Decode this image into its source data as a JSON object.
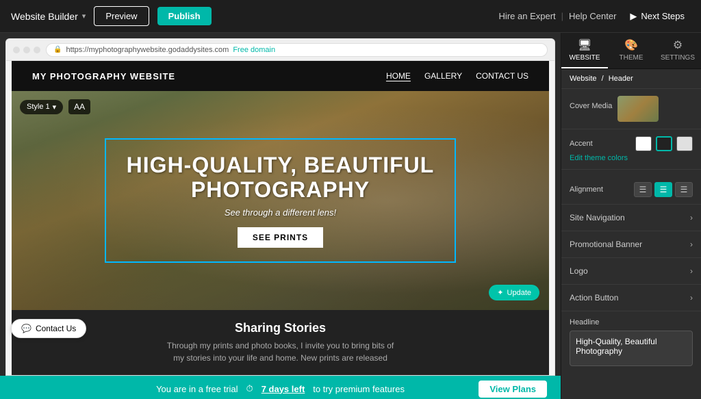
{
  "topbar": {
    "brand": "Website Builder",
    "chevron": "▾",
    "preview_label": "Preview",
    "publish_label": "Publish",
    "hire_expert": "Hire an Expert",
    "help_center": "Help Center",
    "next_steps": "Next Steps",
    "separator": "|"
  },
  "browser": {
    "url": "https://myphotographywebsite.godaddysites.com",
    "free_domain": "Free domain"
  },
  "site": {
    "logo": "MY PHOTOGRAPHY WEBSITE",
    "nav": [
      {
        "label": "HOME",
        "active": true
      },
      {
        "label": "GALLERY",
        "active": false
      },
      {
        "label": "CONTACT US",
        "active": false
      }
    ]
  },
  "hero": {
    "style_label": "Style 1",
    "aa_label": "AA",
    "title_line1": "HIGH-QUALITY, BEAUTIFUL",
    "title_line2": "PHOTOGRAPHY",
    "subtitle": "See through a different lens!",
    "button_label": "SEE PRINTS",
    "update_badge": "Update"
  },
  "below_fold": {
    "title": "Sharing Stories",
    "text": "Through my prints and photo books, I invite you to bring bits of\nmy stories into your life and home. New prints are released"
  },
  "contact_us": {
    "label": "Contact Us",
    "icon": "💬"
  },
  "trial_bar": {
    "text": "You are in a free trial",
    "days_left": "7 days left",
    "suffix": "to try premium features",
    "view_plans": "View Plans",
    "clock_icon": "⏱"
  },
  "right_panel": {
    "tabs": [
      {
        "label": "WEBSITE",
        "icon": "🖥",
        "active": true
      },
      {
        "label": "THEME",
        "icon": "🎨",
        "active": false
      },
      {
        "label": "SETTINGS",
        "icon": "⚙",
        "active": false
      }
    ],
    "breadcrumb": {
      "root": "Website",
      "current": "Header"
    },
    "cover_media": {
      "label": "Cover Media"
    },
    "accent": {
      "label": "Accent",
      "swatches": [
        {
          "color": "#ffffff",
          "selected": false
        },
        {
          "color": "#222222",
          "selected": true
        },
        {
          "color": "#e0e0e0",
          "selected": false
        }
      ],
      "edit_theme": "Edit theme colors"
    },
    "alignment": {
      "label": "Alignment",
      "options": [
        {
          "icon": "≡",
          "name": "left",
          "active": false
        },
        {
          "icon": "≡",
          "name": "center",
          "active": true
        },
        {
          "icon": "≡",
          "name": "right",
          "active": false
        }
      ]
    },
    "collapsibles": [
      {
        "label": "Site Navigation"
      },
      {
        "label": "Promotional Banner"
      },
      {
        "label": "Logo"
      },
      {
        "label": "Action Button"
      }
    ],
    "headline": {
      "label": "Headline",
      "value": "High-Quality, Beautiful Photography"
    }
  }
}
